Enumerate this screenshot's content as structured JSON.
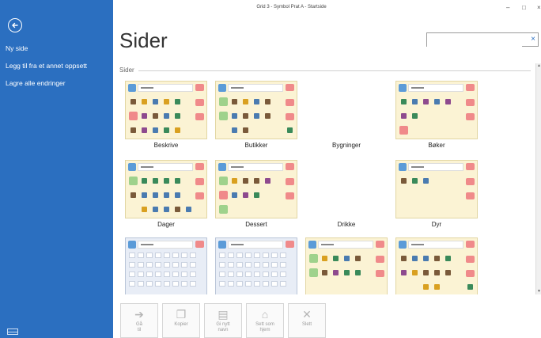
{
  "window": {
    "title": "Grid 3 - Symbol Prat A - Startside",
    "minimize": "–",
    "maximize": "□",
    "close": "×"
  },
  "sidebar": {
    "items": [
      {
        "label": "Ny side"
      },
      {
        "label": "Legg til fra et annet oppsett"
      },
      {
        "label": "Lagre alle endringer"
      }
    ]
  },
  "page": {
    "title": "Sider",
    "section_label": "Sider"
  },
  "search": {
    "value": "",
    "placeholder": "",
    "clear": "×"
  },
  "tiles": [
    {
      "label": "Beskrive"
    },
    {
      "label": "Butikker"
    },
    {
      "label": "Bygninger"
    },
    {
      "label": "Bøker"
    },
    {
      "label": "Dager"
    },
    {
      "label": "Dessert"
    },
    {
      "label": "Drikke"
    },
    {
      "label": "Dyr"
    }
  ],
  "toolbar": {
    "buttons": [
      {
        "label": "Gå\ntil",
        "icon": "arrow-right-icon"
      },
      {
        "label": "Kopier",
        "icon": "copy-icon"
      },
      {
        "label": "Gi nytt\nnavn",
        "icon": "rename-icon"
      },
      {
        "label": "Sett som\nhjem",
        "icon": "home-icon"
      },
      {
        "label": "Slett",
        "icon": "delete-icon"
      }
    ]
  },
  "colors": {
    "sidebar": "#2b6fc0",
    "tile_background": "#fbf3d4"
  }
}
